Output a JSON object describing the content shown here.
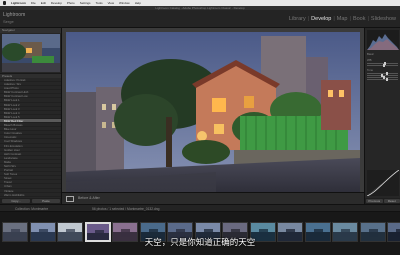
{
  "menubar": {
    "items": [
      "Lightroom",
      "File",
      "Edit",
      "Develop",
      "Photo",
      "Settings",
      "Tools",
      "View",
      "Window",
      "Help"
    ]
  },
  "window": {
    "title": "Lightroom Catalog - Adobe Photoshop Lightroom Classic - Develop"
  },
  "identity": {
    "brand": "Lightroom",
    "user": "Serge"
  },
  "modules": [
    "Library",
    "Develop",
    "Map",
    "Book",
    "Slideshow"
  ],
  "active_module": "Develop",
  "left_panel": {
    "navigator_label": "Navigator",
    "presets_label": "Presets",
    "presets": [
      "Adaptive: Portrait",
      "Adaptive: Sky",
      "Aged Photo",
      "B&W Contrast High",
      "B&W Contrast Low",
      "B&W Look 1",
      "B&W Look 2",
      "B&W Look 3",
      "B&W Look 4",
      "B&W Look 5",
      "B&W Red Filter",
      "Bleach Bypass",
      "Blue Hour",
      "Color Creative",
      "Cinematic",
      "Cool Shadows",
      "Film Emulation",
      "Golden Hour",
      "High Contrast",
      "Landscape",
      "Matte",
      "Night Sky",
      "Portrait",
      "Soft Tones",
      "Street",
      "Travel",
      "Urban",
      "Vintage",
      "Warm Highlights",
      "Warm Sunset",
      "User Presets",
      "Vivid"
    ],
    "selected_preset": 10,
    "copy_label": "Copy...",
    "paste_label": "Paste"
  },
  "right_panel": {
    "rows": [
      "Basic",
      "WB",
      "Temp",
      "Tint",
      "Tone",
      "Exposure",
      "Contrast",
      "Highlights",
      "Shadows",
      "Whites",
      "Blacks"
    ],
    "sliders": [
      0.55,
      0.5,
      0.6,
      0.45,
      0.5,
      0.62
    ],
    "previous_label": "Previous",
    "reset_label": "Reset"
  },
  "toolbar": {
    "label": "Before & After"
  },
  "filmbar": {
    "path": "Collection: Montmartre",
    "detail": "56 photos / 1 selected / Montmartre_0132.dng"
  },
  "filmstrip": {
    "count": 15,
    "selected": 3
  },
  "subtitle": "天空，只是你知道正确的天空"
}
